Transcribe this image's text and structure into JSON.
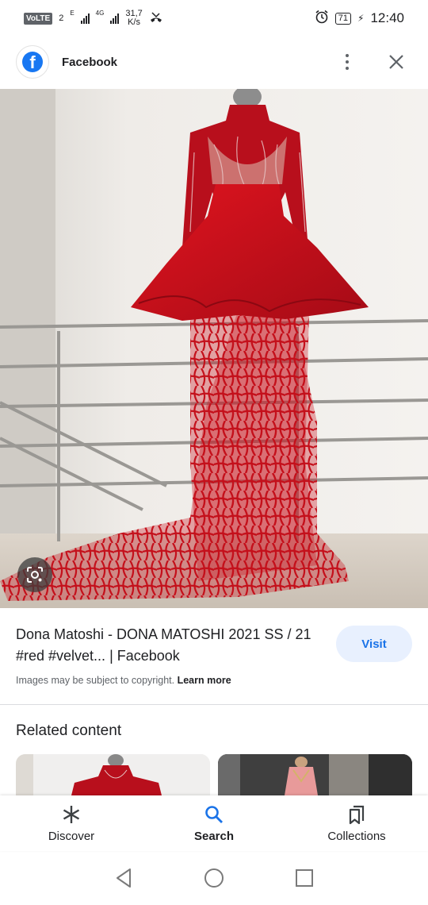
{
  "status_bar": {
    "volte": "VoLTE",
    "sim": "2",
    "net_1": "E",
    "net_2": "4G",
    "speed_value": "31,7",
    "speed_unit": "K/s",
    "battery": "71",
    "time": "12:40"
  },
  "header": {
    "title": "Facebook"
  },
  "result": {
    "title": "Dona Matoshi - DONA MATOSHI 2021 SS / 21 #red #velvet... | Facebook",
    "visit_label": "Visit",
    "copyright_text": "Images may be subject to copyright.",
    "learn_more": "Learn more"
  },
  "related": {
    "heading": "Related content"
  },
  "bottom_nav": {
    "items": [
      {
        "label": "Discover",
        "icon": "asterisk-icon"
      },
      {
        "label": "Search",
        "icon": "search-icon"
      },
      {
        "label": "Collections",
        "icon": "bookmark-icon"
      }
    ],
    "active": "Search"
  },
  "colors": {
    "accent": "#1a73e8",
    "visit_bg": "#e8f0fe",
    "facebook_blue": "#1877f2",
    "dress_red": "#c8101c"
  }
}
